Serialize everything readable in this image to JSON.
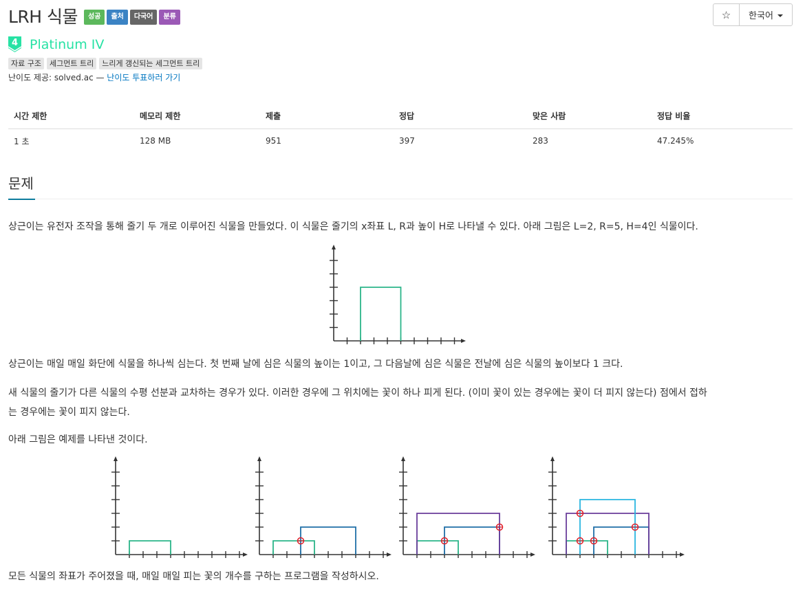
{
  "problem": {
    "title": "LRH 식물",
    "labels": [
      {
        "text": "성공",
        "color": "#5cb85c"
      },
      {
        "text": "출처",
        "color": "#3b83c4"
      },
      {
        "text": "다국어",
        "color": "#666666"
      },
      {
        "text": "분류",
        "color": "#9b59b6"
      }
    ],
    "tier_number": "4",
    "tier_name": "Platinum IV",
    "tier_color": "#27e2a4",
    "tags": [
      "자료 구조",
      "세그먼트 트리",
      "느리게 갱신되는 세그먼트 트리"
    ],
    "credit_prefix": "난이도 제공: solved.ac — ",
    "credit_link": "난이도 투표하러 가기"
  },
  "toolbar": {
    "star_icon": "star-icon",
    "language": "한국어"
  },
  "stats": {
    "headers": [
      "시간 제한",
      "메모리 제한",
      "제출",
      "정답",
      "맞은 사람",
      "정답 비율"
    ],
    "values": [
      "1 초",
      "128 MB",
      "951",
      "397",
      "283",
      "47.245%"
    ]
  },
  "section": {
    "title": "문제"
  },
  "statement": {
    "p1": "상근이는 유전자 조작을 통해 줄기 두 개로 이루어진 식물을 만들었다. 이 식물은 줄기의 x좌표 L, R과 높이 H로 나타낼 수 있다. 아래 그림은 L=2, R=5, H=4인 식물이다.",
    "p2": "상근이는 매일 매일 화단에 식물을 하나씩 심는다. 첫 번째 날에 심은 식물의 높이는 1이고, 그 다음날에 심은 식물은 전날에 심은 식물의 높이보다 1 크다.",
    "p3_line1": "새 식물의 줄기가 다른 식물의 수평 선분과 교차하는 경우가 있다. 이러한 경우에 그 위치에는 꽃이 하나 피게 된다. (이미 꽃이 있는 경우에는 꽃이 더 피지 않는다) 점에서 접하",
    "p3_line2": "는 경우에는 꽃이 피지 않는다.",
    "p4": "아래 그림은 예제를 나타낸 것이다.",
    "p5": "모든 식물의 좌표가 주어졌을 때, 매일 매일 피는 꽃의 개수를 구하는 프로그램을 작성하시오."
  },
  "figures": {
    "single_plant": {
      "L": 2,
      "R": 5,
      "H": 4,
      "color": "#2bb589"
    },
    "example_plants": [
      {
        "L": 1,
        "R": 4,
        "H": 1,
        "color": "#2bb589"
      },
      {
        "L": 3,
        "R": 7,
        "H": 2,
        "color": "#1f6fa8"
      },
      {
        "L": 1,
        "R": 7,
        "H": 3,
        "color": "#6a3d9a"
      },
      {
        "L": 2,
        "R": 6,
        "H": 4,
        "color": "#29b6e0"
      }
    ],
    "flower_color": "#e0202a",
    "flowers": [
      [],
      [
        [
          3,
          1
        ]
      ],
      [
        [
          3,
          1
        ],
        [
          7,
          2
        ]
      ],
      [
        [
          2,
          3
        ],
        [
          2,
          1
        ],
        [
          3,
          1
        ],
        [
          6,
          2
        ]
      ]
    ]
  }
}
